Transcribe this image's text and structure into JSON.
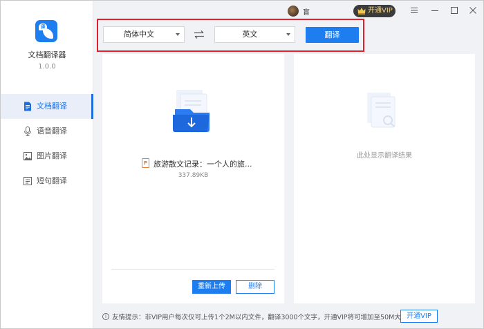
{
  "app": {
    "name": "文档翻译器",
    "version": "1.0.0"
  },
  "sidebar": {
    "items": [
      {
        "label": "文档翻译",
        "icon": "document-icon",
        "active": true
      },
      {
        "label": "语音翻译",
        "icon": "microphone-icon",
        "active": false
      },
      {
        "label": "图片翻译",
        "icon": "image-icon",
        "active": false
      },
      {
        "label": "短句翻译",
        "icon": "sentence-icon",
        "active": false
      }
    ]
  },
  "titlebar": {
    "username": "盲",
    "vip_label": "开通VIP"
  },
  "toolbar": {
    "source_language": "简体中文",
    "target_language": "英文",
    "translate_label": "翻译"
  },
  "left_panel": {
    "file_type": "P",
    "file_name": "旅游散文记录：一个人的旅...",
    "file_size": "337.89KB",
    "reupload_label": "重新上传",
    "delete_label": "删除"
  },
  "right_panel": {
    "placeholder": "此处显示翻译结果"
  },
  "footer": {
    "notice": "友情提示：非VIP用户每次仅可上传1个2M以内文件，翻译3000个文字，开通VIP将可增加至50M大文件",
    "vip_button": "开通VIP"
  },
  "colors": {
    "accent": "#1e7ef0",
    "highlight": "#e0202a",
    "file_icon": "#e5792c"
  }
}
